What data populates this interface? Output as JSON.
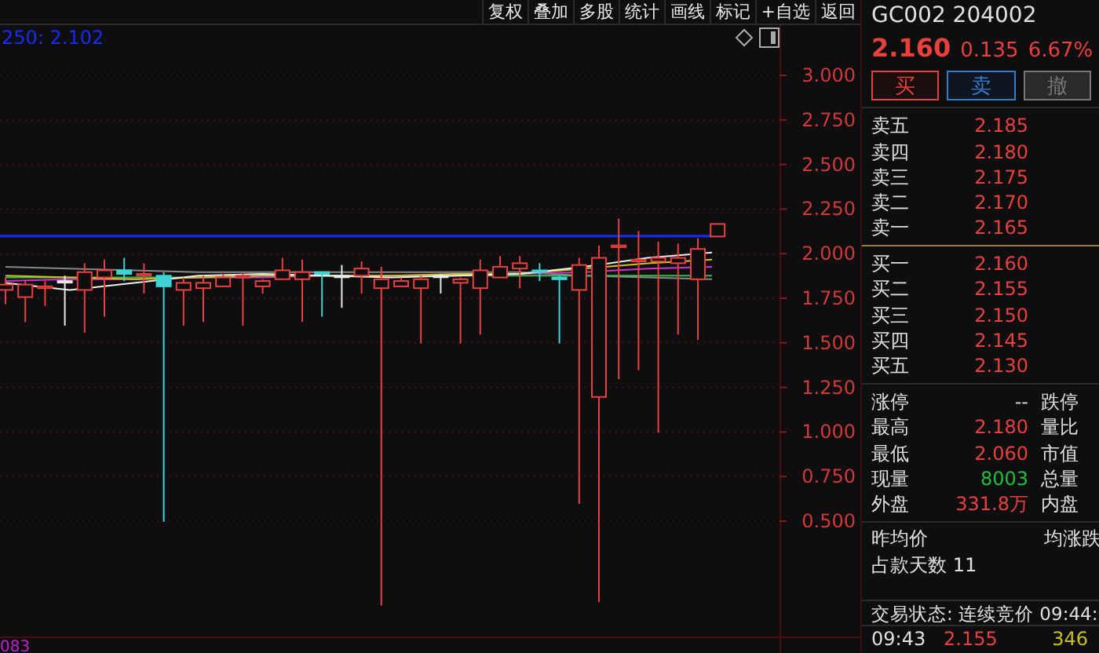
{
  "toolbar": {
    "buttons": [
      "复权",
      "叠加",
      "多股",
      "统计",
      "画线",
      "标记",
      "+自选",
      "返回"
    ]
  },
  "chart": {
    "ma_label": "250: 2.102",
    "y_axis_labels": [
      "3.000",
      "2.750",
      "2.500",
      "2.250",
      "2.000",
      "1.750",
      "1.500",
      "1.250",
      "1.000",
      "0.750",
      "0.500"
    ],
    "bottom_label": "083"
  },
  "quote": {
    "code": "GC002 204002",
    "price": "2.160",
    "change": "0.135",
    "change_pct": "6.67%"
  },
  "trade_buttons": [
    {
      "label": "买",
      "kind": "buy"
    },
    {
      "label": "卖",
      "kind": "sell"
    },
    {
      "label": "撤",
      "kind": "cancel"
    }
  ],
  "asks": [
    {
      "label": "卖五",
      "price": "2.185"
    },
    {
      "label": "卖四",
      "price": "2.180"
    },
    {
      "label": "卖三",
      "price": "2.175"
    },
    {
      "label": "卖二",
      "price": "2.170"
    },
    {
      "label": "卖一",
      "price": "2.165"
    }
  ],
  "bids": [
    {
      "label": "买一",
      "price": "2.160"
    },
    {
      "label": "买二",
      "price": "2.155"
    },
    {
      "label": "买三",
      "price": "2.150"
    },
    {
      "label": "买四",
      "price": "2.145"
    },
    {
      "label": "买五",
      "price": "2.130"
    }
  ],
  "stats": [
    {
      "label": "涨停",
      "value": "--",
      "color": "#d0d0d0",
      "label_2": "跌停"
    },
    {
      "label": "最高",
      "value": "2.180",
      "color": "#e8413c",
      "label_2": "量比"
    },
    {
      "label": "最低",
      "value": "2.060",
      "color": "#e8413c",
      "label_2": "市值"
    },
    {
      "label": "现量",
      "value": "8003",
      "color": "#1fbf3a",
      "label_2": "总量"
    },
    {
      "label": "外盘",
      "value": "331.8万",
      "color": "#e8413c",
      "label_2": "内盘"
    }
  ],
  "info": {
    "prev_avg_label": "昨均价",
    "avg_change_label": "均涨跌",
    "days": "占款天数 11"
  },
  "status": "交易状态: 连续竞价 09:44:",
  "ticks": [
    {
      "time": "09:43",
      "price": "2.155",
      "volume": "346"
    }
  ]
}
